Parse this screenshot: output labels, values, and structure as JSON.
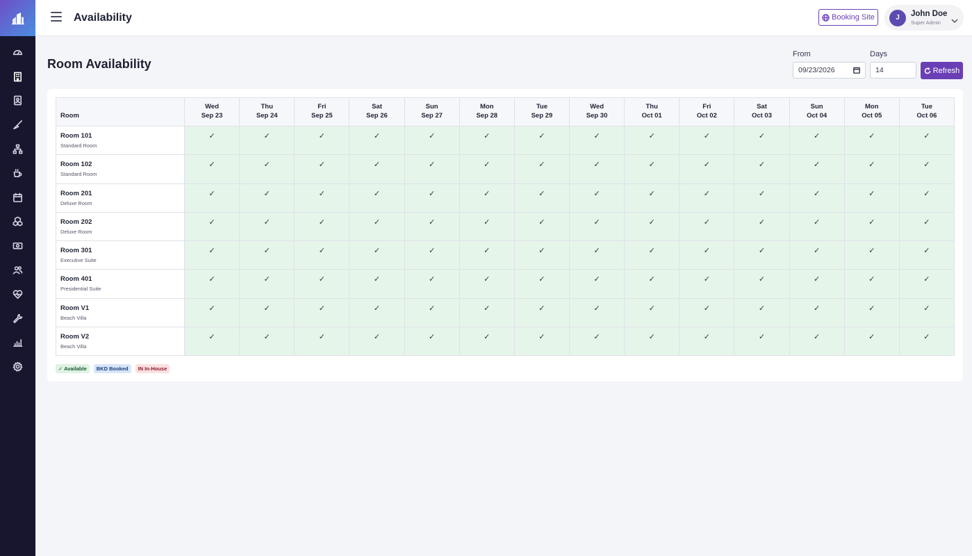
{
  "header": {
    "title": "Availability",
    "booking_site_label": "Booking Site"
  },
  "user": {
    "initial": "J",
    "name": "John Doe",
    "role": "Super Admin"
  },
  "sidebar": {
    "icons": [
      "dashboard-icon",
      "building-icon",
      "reservation-icon",
      "housekeeping-icon",
      "hierarchy-icon",
      "coffee-icon",
      "calendar-icon",
      "packages-icon",
      "payments-icon",
      "guests-icon",
      "health-icon",
      "maintenance-icon",
      "reports-icon",
      "settings-icon"
    ],
    "active_index": 1
  },
  "page": {
    "title": "Room Availability",
    "from_label": "From",
    "from_value": "09/23/2026",
    "days_label": "Days",
    "days_value": "14",
    "refresh_label": "Refresh"
  },
  "table": {
    "room_header": "Room",
    "dates": [
      {
        "day": "Wed",
        "date": "Sep 23"
      },
      {
        "day": "Thu",
        "date": "Sep 24"
      },
      {
        "day": "Fri",
        "date": "Sep 25"
      },
      {
        "day": "Sat",
        "date": "Sep 26"
      },
      {
        "day": "Sun",
        "date": "Sep 27"
      },
      {
        "day": "Mon",
        "date": "Sep 28"
      },
      {
        "day": "Tue",
        "date": "Sep 29"
      },
      {
        "day": "Wed",
        "date": "Sep 30"
      },
      {
        "day": "Thu",
        "date": "Oct 01"
      },
      {
        "day": "Fri",
        "date": "Oct 02"
      },
      {
        "day": "Sat",
        "date": "Oct 03"
      },
      {
        "day": "Sun",
        "date": "Oct 04"
      },
      {
        "day": "Mon",
        "date": "Oct 05"
      },
      {
        "day": "Tue",
        "date": "Oct 06"
      }
    ],
    "rooms": [
      {
        "name": "Room 101",
        "type": "Standard Room"
      },
      {
        "name": "Room 102",
        "type": "Standard Room"
      },
      {
        "name": "Room 201",
        "type": "Deluxe Room"
      },
      {
        "name": "Room 202",
        "type": "Deluxe Room"
      },
      {
        "name": "Room 301",
        "type": "Executive Suite"
      },
      {
        "name": "Room 401",
        "type": "Presidential Suite"
      },
      {
        "name": "Room V1",
        "type": "Beach Villa"
      },
      {
        "name": "Room V2",
        "type": "Beach Villa"
      }
    ],
    "available_mark": "✓"
  },
  "legend": {
    "available": "✓ Available",
    "booked": "BKD Booked",
    "inhouse": "IN In-House"
  },
  "colors": {
    "sidebar_bg": "#17162e",
    "accent": "#6a3fb5",
    "available_bg": "#e6f5ea"
  }
}
